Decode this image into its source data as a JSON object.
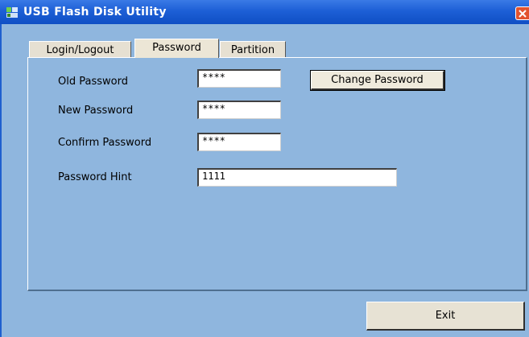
{
  "window": {
    "title": "USB Flash Disk Utility",
    "titlebar_color": "#1d5fd6",
    "background_color": "#8fb6de",
    "app_icon": "usb-disk-icon",
    "close_icon": "close-icon"
  },
  "tabs": [
    {
      "label": "Login/Logout",
      "selected": false
    },
    {
      "label": "Password",
      "selected": true
    },
    {
      "label": "Partition",
      "selected": false
    }
  ],
  "form": {
    "old_password": {
      "label": "Old Password",
      "value": "****"
    },
    "new_password": {
      "label": "New Password",
      "value": "****"
    },
    "confirm_password": {
      "label": "Confirm Password",
      "value": "****"
    },
    "password_hint": {
      "label": "Password Hint",
      "value": "1111"
    }
  },
  "buttons": {
    "change_password": "Change Password",
    "exit": "Exit"
  }
}
